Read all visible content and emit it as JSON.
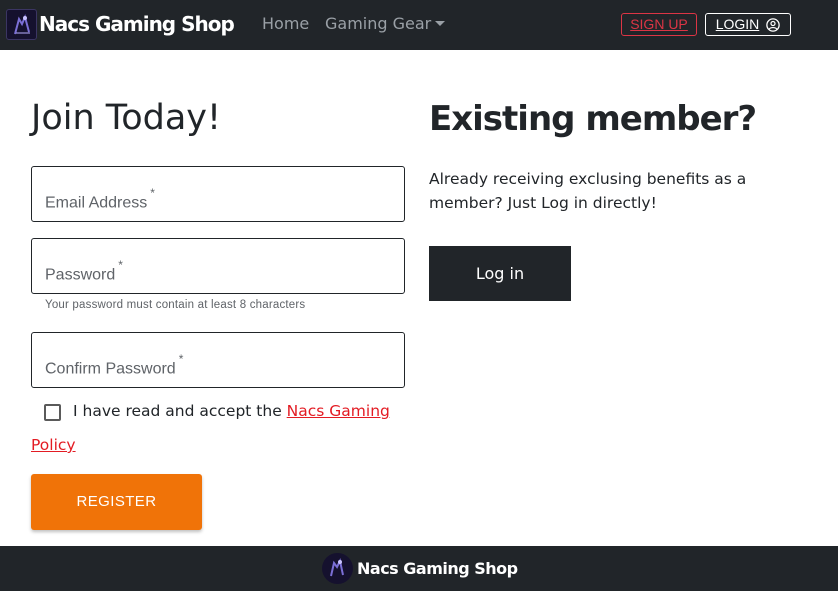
{
  "navbar": {
    "brand_name": "Nacs Gaming Shop",
    "logo_icon": "gaming-logo-icon",
    "links": [
      {
        "label": "Home"
      },
      {
        "label": "Gaming Gear"
      }
    ],
    "signup_label": "SIGN UP",
    "login_label": "LOGIN",
    "login_icon": "user-circle-icon"
  },
  "register_form": {
    "title": "Join Today!",
    "email_placeholder": "Email Address",
    "password_placeholder": "Password",
    "password_helper": "Your password must contain at least 8 characters",
    "confirm_placeholder": "Confirm Password",
    "required_mark": "*",
    "accept_text": "I have read and accept the ",
    "policy_link_part1": "Nacs Gaming",
    "policy_link_part2": "Policy",
    "accept_checked": false,
    "register_label": "REGISTER"
  },
  "existing_member": {
    "title": "Existing member?",
    "description": "Already receiving exclusing benefits as a member? Just Log in directly!",
    "login_label": "Log in"
  },
  "footer": {
    "brand_name": "Nacs Gaming Shop"
  },
  "colors": {
    "navbar_bg": "#212529",
    "accent_red": "#dc3545",
    "policy_red": "#e31b23",
    "register_orange": "#f07308",
    "dark_button": "#212529"
  }
}
